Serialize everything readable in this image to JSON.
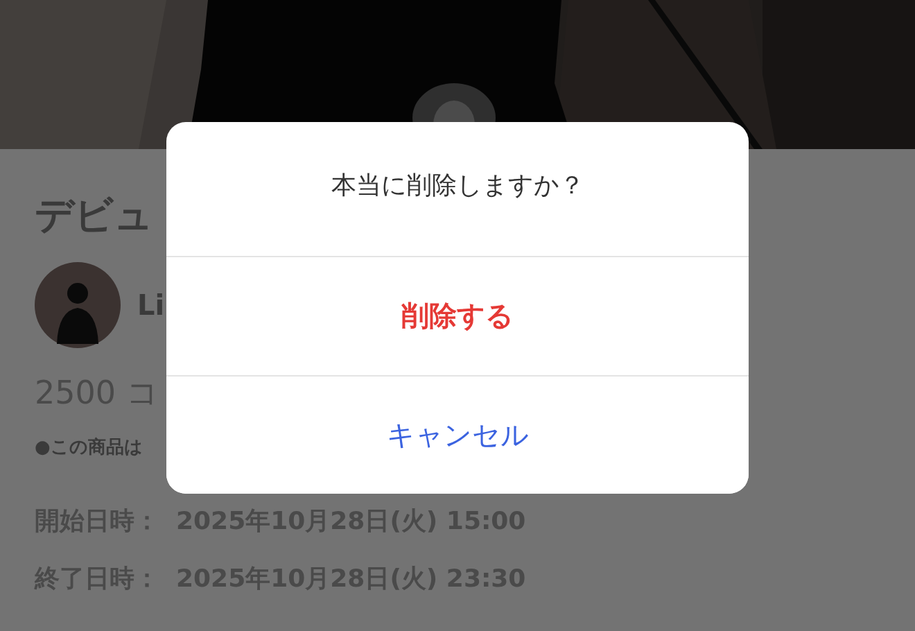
{
  "background": {
    "title": "デビュ",
    "seller": {
      "name": "Li"
    },
    "price": "2500 コ",
    "note": "●この商品は",
    "schedule": [
      {
        "label": "開始日時：",
        "value": "2025年10月28日(火) 15:00"
      },
      {
        "label": "終了日時：",
        "value": "2025年10月28日(火) 23:30"
      }
    ]
  },
  "dialog": {
    "message": "本当に削除しますか？",
    "actions": [
      {
        "label": "削除する",
        "kind": "destructive"
      },
      {
        "label": "キャンセル",
        "kind": "cancel"
      }
    ]
  }
}
